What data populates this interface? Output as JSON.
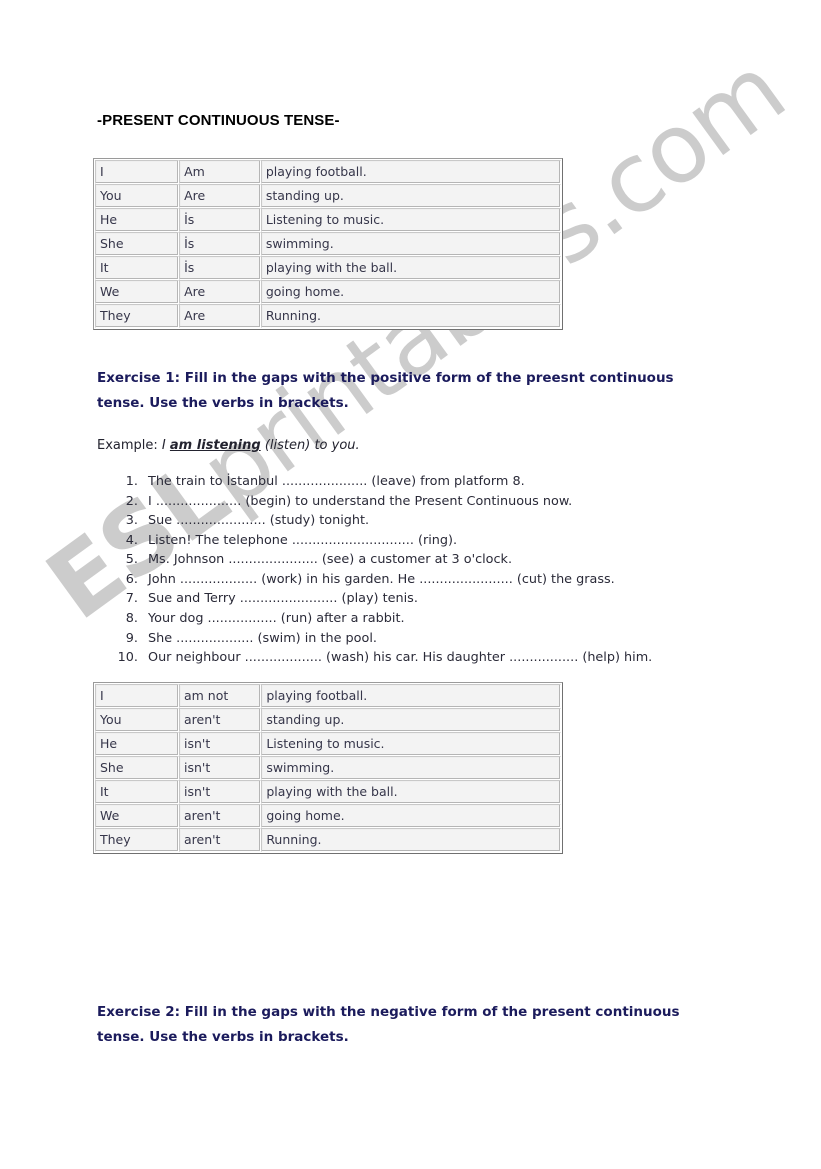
{
  "document": {
    "title": "-PRESENT CONTINUOUS TENSE-",
    "watermark": {
      "bold_part": "ESL",
      "normal_part": "printables.com"
    }
  },
  "positive_table": {
    "name": "positive-forms-table",
    "rows": [
      {
        "subject": "I",
        "auxiliary": "Am",
        "predicate": "playing football."
      },
      {
        "subject": "You",
        "auxiliary": "Are",
        "predicate": "standing up."
      },
      {
        "subject": "He",
        "auxiliary": "İs",
        "predicate": "Listening to music."
      },
      {
        "subject": "She",
        "auxiliary": "İs",
        "predicate": "swimming."
      },
      {
        "subject": "It",
        "auxiliary": "İs",
        "predicate": "playing with the ball."
      },
      {
        "subject": "We",
        "auxiliary": "Are",
        "predicate": "going home."
      },
      {
        "subject": "They",
        "auxiliary": "Are",
        "predicate": "Running."
      }
    ]
  },
  "negative_table": {
    "name": "negative-forms-table",
    "rows": [
      {
        "subject": "I",
        "auxiliary": "am not",
        "predicate": "playing football."
      },
      {
        "subject": "You",
        "auxiliary": "aren't",
        "predicate": "standing up."
      },
      {
        "subject": "He",
        "auxiliary": "isn't",
        "predicate": "Listening to music."
      },
      {
        "subject": "She",
        "auxiliary": "isn't",
        "predicate": "swimming."
      },
      {
        "subject": "It",
        "auxiliary": "isn't",
        "predicate": "playing with the ball."
      },
      {
        "subject": "We",
        "auxiliary": "aren't",
        "predicate": "going home."
      },
      {
        "subject": "They",
        "auxiliary": "aren't",
        "predicate": "Running."
      }
    ]
  },
  "exercise1": {
    "heading_line1": "Exercise 1: Fill in the gaps with the positive form of the preesnt continuous",
    "heading_line2": "tense. Use the verbs in brackets.",
    "example": {
      "label": "Example:",
      "subject": "I",
      "answer": "am listening",
      "rest": "(listen) to you."
    },
    "items": [
      "The train to İstanbul ..................... (leave) from platform 8.",
      "I ..................... (begin) to understand the Present Continuous now.",
      "Sue ...................... (study) tonight.",
      "Listen! The telephone .............................. (ring).",
      "Ms. Johnson ...................... (see) a customer at 3 o'clock.",
      "John ................... (work) in his garden. He ....................... (cut) the grass.",
      "Sue and Terry ........................ (play) tenis.",
      "Your dog ................. (run) after a rabbit.",
      "She ................... (swim) in the pool.",
      "Our neighbour ................... (wash) his car. His daughter ................. (help) him."
    ]
  },
  "exercise2": {
    "heading_line1": "Exercise 2: Fill in the gaps with the negative form of the present continuous",
    "heading_line2": "tense. Use the verbs in brackets."
  },
  "colors": {
    "heading_navy": "#1b1b5c",
    "table_text": "#36364a",
    "watermark_gray": "#cccccc",
    "page_background": "#ffffff"
  }
}
